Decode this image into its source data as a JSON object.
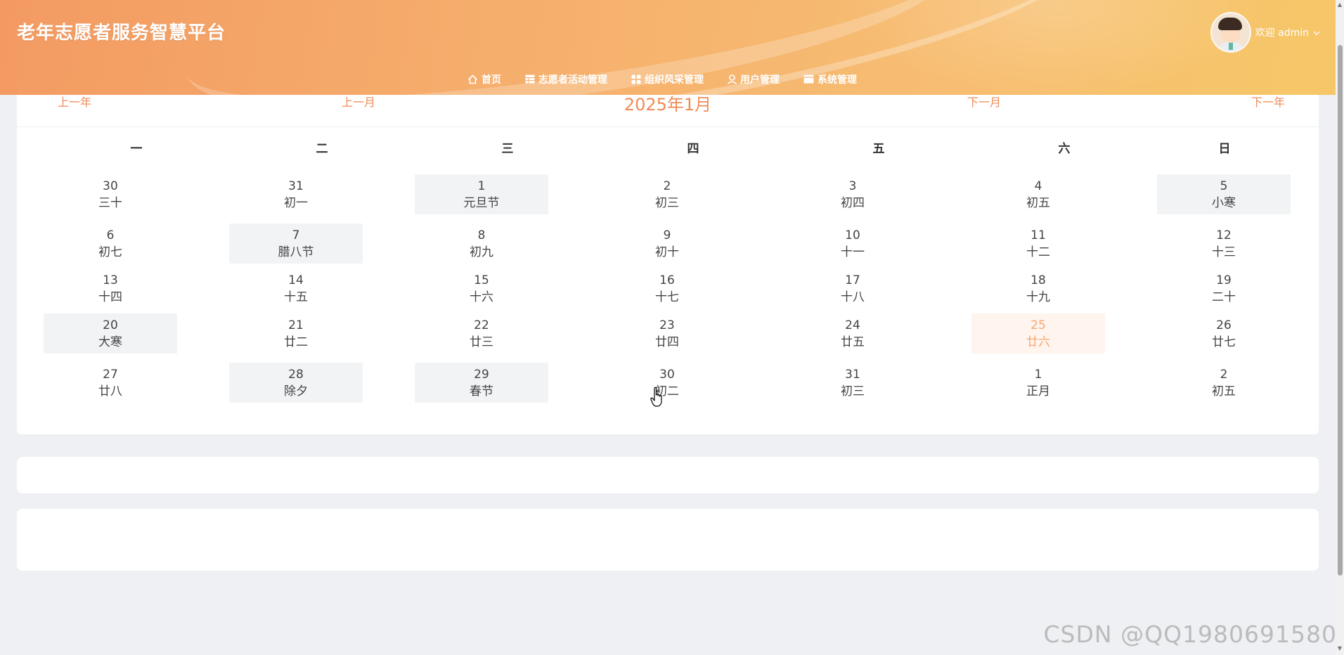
{
  "header": {
    "title": "老年志愿者服务智慧平台",
    "welcome": "欢迎 admin",
    "nav": [
      {
        "label": "首页",
        "icon": "home-icon"
      },
      {
        "label": "志愿者活动管理",
        "icon": "table-icon"
      },
      {
        "label": "组织风采管理",
        "icon": "grid-icon"
      },
      {
        "label": "用户管理",
        "icon": "user-icon"
      },
      {
        "label": "系统管理",
        "icon": "window-icon"
      }
    ]
  },
  "calendar": {
    "prev_year": "上一年",
    "prev_month": "上一月",
    "title": "2025年1月",
    "next_month": "下一月",
    "next_year": "下一年",
    "weekdays": [
      "一",
      "二",
      "三",
      "四",
      "五",
      "六",
      "日"
    ],
    "days": [
      {
        "num": "30",
        "lunar": "三十",
        "state": ""
      },
      {
        "num": "31",
        "lunar": "初一",
        "state": ""
      },
      {
        "num": "1",
        "lunar": "元旦节",
        "state": "holiday"
      },
      {
        "num": "2",
        "lunar": "初三",
        "state": ""
      },
      {
        "num": "3",
        "lunar": "初四",
        "state": ""
      },
      {
        "num": "4",
        "lunar": "初五",
        "state": ""
      },
      {
        "num": "5",
        "lunar": "小寒",
        "state": "holiday"
      },
      {
        "num": "6",
        "lunar": "初七",
        "state": ""
      },
      {
        "num": "7",
        "lunar": "腊八节",
        "state": "holiday"
      },
      {
        "num": "8",
        "lunar": "初九",
        "state": ""
      },
      {
        "num": "9",
        "lunar": "初十",
        "state": ""
      },
      {
        "num": "10",
        "lunar": "十一",
        "state": ""
      },
      {
        "num": "11",
        "lunar": "十二",
        "state": ""
      },
      {
        "num": "12",
        "lunar": "十三",
        "state": ""
      },
      {
        "num": "13",
        "lunar": "十四",
        "state": ""
      },
      {
        "num": "14",
        "lunar": "十五",
        "state": ""
      },
      {
        "num": "15",
        "lunar": "十六",
        "state": ""
      },
      {
        "num": "16",
        "lunar": "十七",
        "state": ""
      },
      {
        "num": "17",
        "lunar": "十八",
        "state": ""
      },
      {
        "num": "18",
        "lunar": "十九",
        "state": ""
      },
      {
        "num": "19",
        "lunar": "二十",
        "state": ""
      },
      {
        "num": "20",
        "lunar": "大寒",
        "state": "holiday"
      },
      {
        "num": "21",
        "lunar": "廿二",
        "state": ""
      },
      {
        "num": "22",
        "lunar": "廿三",
        "state": ""
      },
      {
        "num": "23",
        "lunar": "廿四",
        "state": ""
      },
      {
        "num": "24",
        "lunar": "廿五",
        "state": ""
      },
      {
        "num": "25",
        "lunar": "廿六",
        "state": "today"
      },
      {
        "num": "26",
        "lunar": "廿七",
        "state": ""
      },
      {
        "num": "27",
        "lunar": "廿八",
        "state": ""
      },
      {
        "num": "28",
        "lunar": "除夕",
        "state": "holiday"
      },
      {
        "num": "29",
        "lunar": "春节",
        "state": "holiday"
      },
      {
        "num": "30",
        "lunar": "初二",
        "state": ""
      },
      {
        "num": "31",
        "lunar": "初三",
        "state": ""
      },
      {
        "num": "1",
        "lunar": "正月",
        "state": ""
      },
      {
        "num": "2",
        "lunar": "初五",
        "state": ""
      }
    ]
  },
  "colors": {
    "accent": "#f08b57",
    "today_bg": "#fff4ee",
    "today_text": "#f4a873",
    "holiday_bg": "#f2f3f5"
  },
  "watermark": "CSDN @QQ1980691580"
}
